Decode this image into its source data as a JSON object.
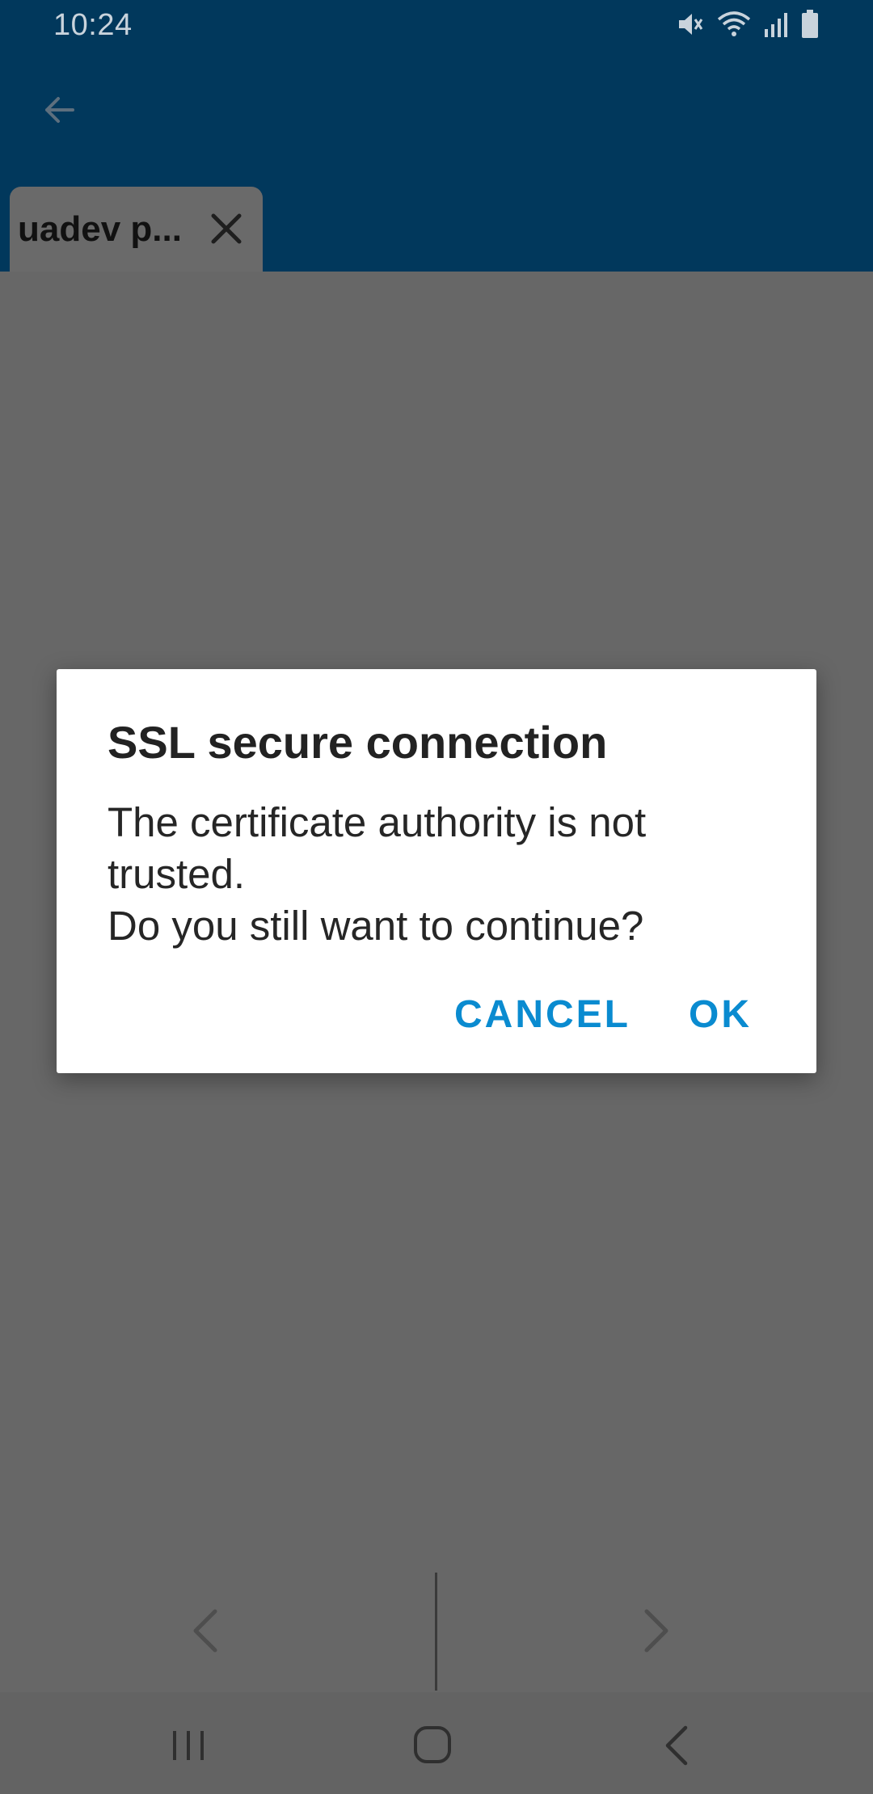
{
  "status_bar": {
    "time": "10:24",
    "icons": [
      "mute-icon",
      "wifi-icon",
      "signal-icon",
      "battery-icon"
    ]
  },
  "appbar": {
    "back_icon": "back-arrow-icon",
    "tab": {
      "label": "uadev p...",
      "close_icon": "close-icon"
    }
  },
  "dialog": {
    "title": "SSL secure connection",
    "message_lines": [
      "The certificate authority is not",
      "trusted.",
      "Do you still want to continue?"
    ],
    "cancel_label": "CANCEL",
    "ok_label": "OK"
  },
  "browser_nav": {
    "prev_icon": "chevron-left-icon",
    "next_icon": "chevron-right-icon"
  },
  "system_nav": {
    "recents_icon": "recents-icon",
    "home_icon": "home-icon",
    "back_icon": "system-back-icon"
  },
  "colors": {
    "appbar": "#01385c",
    "scrim_background": "#676767",
    "dialog_background": "#ffffff",
    "dialog_button": "#0a8bd0"
  }
}
